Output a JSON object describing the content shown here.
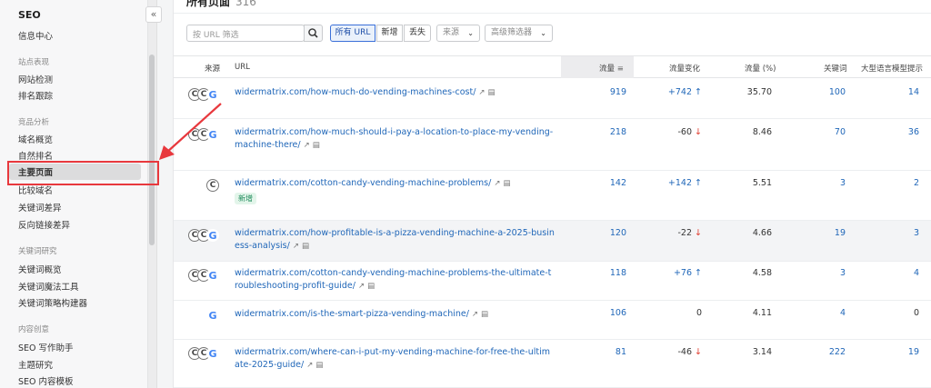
{
  "sidebar": {
    "title": "SEO",
    "collapse_glyph": "«",
    "info_center": "信息中心",
    "groups": [
      {
        "label": "站点表现",
        "items": [
          "网站检测",
          "排名跟踪"
        ]
      },
      {
        "label": "竞品分析",
        "items": [
          "域名概览",
          "自然排名",
          "主要页面",
          "比较域名",
          "关键词差异",
          "反向链接差异"
        ]
      },
      {
        "label": "关键词研究",
        "items": [
          "关键词概览",
          "关键词魔法工具",
          "关键词策略构建器"
        ]
      },
      {
        "label": "内容创意",
        "items": [
          "SEO 写作助手",
          "主题研究",
          "SEO 内容模板"
        ]
      }
    ],
    "active_item": "主要页面"
  },
  "main": {
    "title": "所有页面",
    "count": "316",
    "search_placeholder": "按 URL 筛选",
    "tabs": [
      "所有 URL",
      "新增",
      "丢失"
    ],
    "active_tab": "所有 URL",
    "source_dropdown": "来源",
    "advanced_filter": "高级筛选器"
  },
  "table": {
    "headers": [
      "来源",
      "URL",
      "流量",
      "流量变化",
      "流量 (%)",
      "关键词",
      "大型语言模型提示"
    ],
    "sorted_column": "流量",
    "rows": [
      {
        "sources": [
          "c",
          "c",
          "g"
        ],
        "url": "widermatrix.com/how-much-do-vending-machines-cost/",
        "traffic": "919",
        "change": "+742",
        "dir": "up",
        "pct": "35.70",
        "keywords": "100",
        "llm": "14"
      },
      {
        "sources": [
          "c",
          "c",
          "g"
        ],
        "url": "widermatrix.com/how-much-should-i-pay-a-location-to-place-my-vending-machine-there/",
        "traffic": "218",
        "change": "-60",
        "dir": "down",
        "pct": "8.46",
        "keywords": "70",
        "llm": "36"
      },
      {
        "sources": [
          "c"
        ],
        "url": "widermatrix.com/cotton-candy-vending-machine-problems/",
        "traffic": "142",
        "change": "+142",
        "dir": "up",
        "pct": "5.51",
        "keywords": "3",
        "llm": "2",
        "badge": "新增"
      },
      {
        "sources": [
          "c",
          "c",
          "g"
        ],
        "url": "widermatrix.com/how-profitable-is-a-pizza-vending-machine-a-2025-business-analysis/",
        "traffic": "120",
        "change": "-22",
        "dir": "down",
        "pct": "4.66",
        "keywords": "19",
        "llm": "3"
      },
      {
        "sources": [
          "c",
          "c",
          "g"
        ],
        "url": "widermatrix.com/cotton-candy-vending-machine-problems-the-ultimate-troubleshooting-profit-guide/",
        "traffic": "118",
        "change": "+76",
        "dir": "up",
        "pct": "4.58",
        "keywords": "3",
        "llm": "4"
      },
      {
        "sources": [
          "g"
        ],
        "url": "widermatrix.com/is-the-smart-pizza-vending-machine/",
        "traffic": "106",
        "change": "0",
        "dir": "none",
        "pct": "4.11",
        "keywords": "4",
        "llm": "0"
      },
      {
        "sources": [
          "c",
          "c",
          "g"
        ],
        "url": "widermatrix.com/where-can-i-put-my-vending-machine-for-free-the-ultimate-2025-guide/",
        "traffic": "81",
        "change": "-46",
        "dir": "down",
        "pct": "3.14",
        "keywords": "222",
        "llm": "19"
      }
    ]
  },
  "colors": {
    "link": "#1f66b8",
    "down": "#e0392b",
    "annotation": "#e8383d",
    "badge_text": "#1d8a5a"
  },
  "icons": {
    "sources_c": "chatgpt-icon",
    "sources_g": "google-icon",
    "external": "external-link-icon",
    "doc": "document-icon",
    "search": "search-icon"
  }
}
